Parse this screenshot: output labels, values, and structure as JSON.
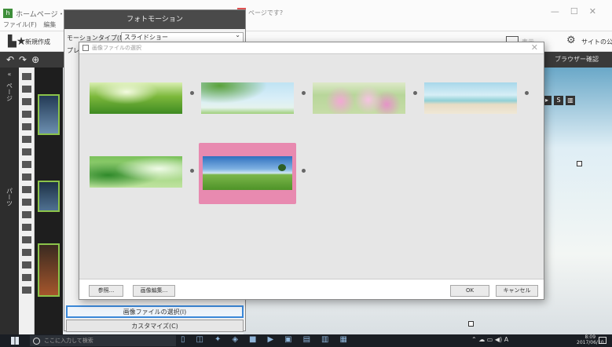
{
  "app": {
    "title": "ホームページ・ビルダー",
    "menu": [
      "ファイル(F)",
      "編集"
    ],
    "browser_tab": "ページです?",
    "toolbar_new": "新規作成",
    "toolbar_publish": "サイトの公開",
    "toolbar_right_label": "表示",
    "browser_confirm": "ブラウザー確認",
    "left_rail_top": "ページ",
    "left_rail_bottom": "パーツ"
  },
  "photo_panel": {
    "title": "フォトモーション",
    "motion_type_label": "モーションタイプ(M)",
    "motion_type_value": "スライドショー",
    "preview_label": "プレビ",
    "select_image_button": "画像ファイルの選択(I)",
    "customize_button": "カスタマイズ(C)"
  },
  "dialog": {
    "title": "画像ファイルの選択",
    "images": [
      {
        "name": "clover",
        "selected": false
      },
      {
        "name": "leaves-sky",
        "selected": false
      },
      {
        "name": "cosmos",
        "selected": false
      },
      {
        "name": "beach",
        "selected": false
      },
      {
        "name": "green-leaves",
        "selected": false
      },
      {
        "name": "field-tree",
        "selected": true
      }
    ],
    "browse_button": "参照...",
    "edit_button": "画像編集...",
    "ok_button": "OK",
    "cancel_button": "キャンセル"
  },
  "taskbar": {
    "search_placeholder": "ここに入力して検索",
    "time": "8:09",
    "date": "2017/06/10",
    "ime": "A"
  },
  "colors": {
    "selection_pink": "#e88ab0",
    "primary_button_border": "#3b88d8",
    "panel_title_bg": "#4a4a4a"
  }
}
